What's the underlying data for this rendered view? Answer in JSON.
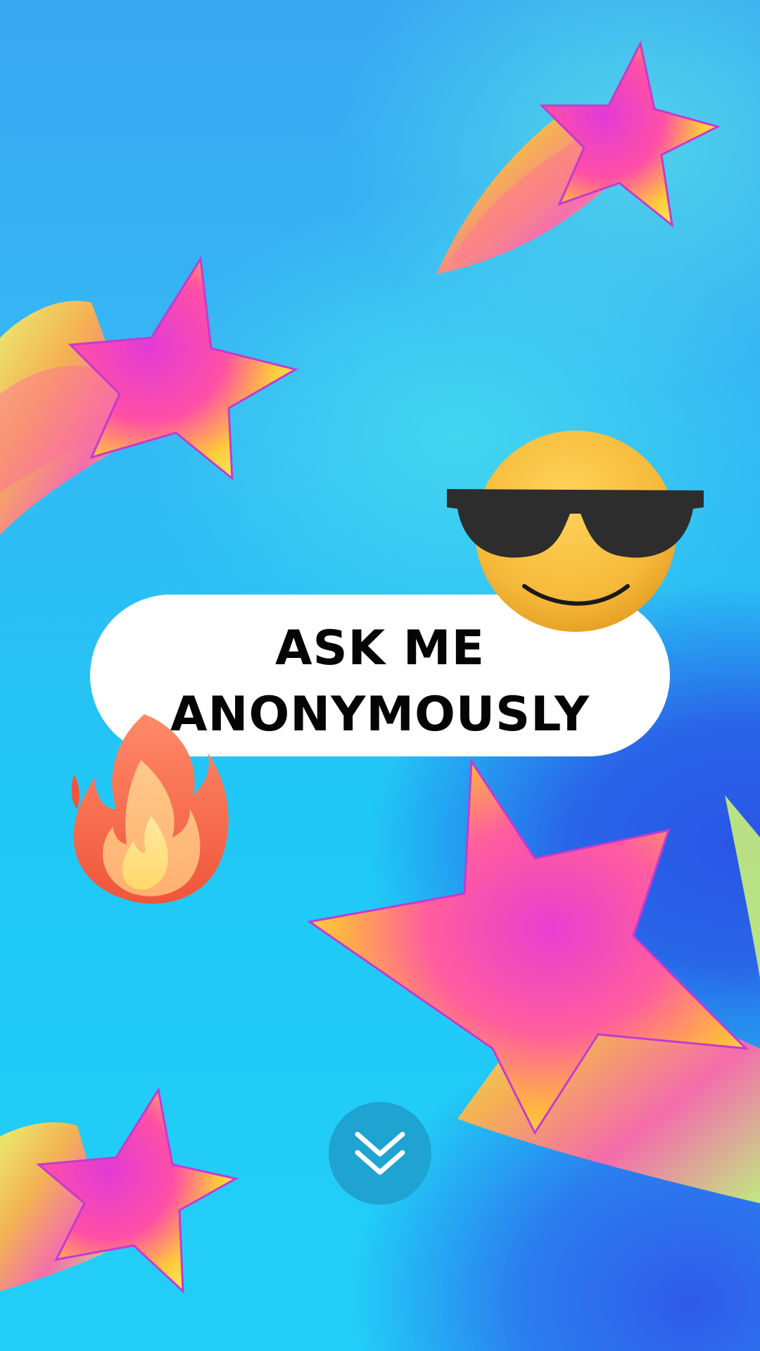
{
  "headline": {
    "line1": "ASK ME",
    "line2": "ANONYMOUSLY"
  },
  "decorations": {
    "star_icon": "shooting-star-icon",
    "cool_face_icon": "smiling-face-with-sunglasses-icon",
    "fire_icon": "fire-icon"
  },
  "scroll_button": {
    "icon": "double-chevron-down-icon"
  },
  "colors": {
    "background_top": "#39a7f2",
    "background_bottom": "#22cff8",
    "accent_blue": "#2a55e6",
    "pill": "#ffffff",
    "headline_text": "#050505",
    "scroll_button": "#1fa3d1"
  }
}
